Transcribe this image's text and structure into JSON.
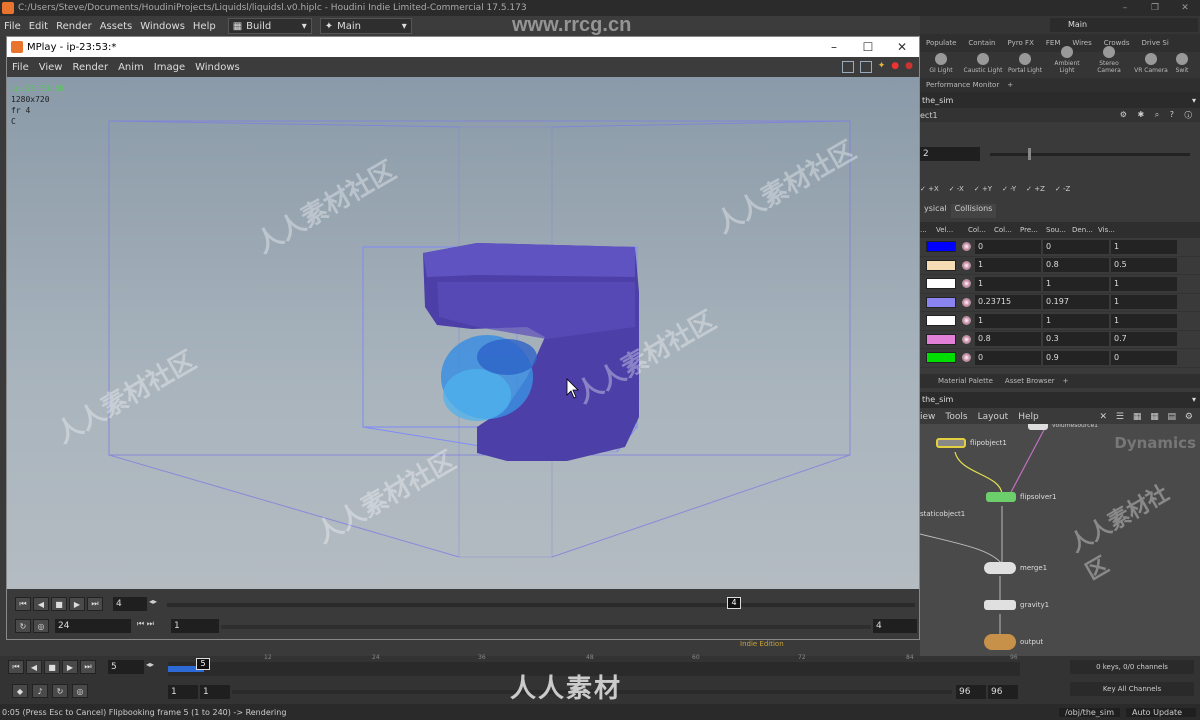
{
  "titlebar": {
    "title": "C:/Users/Steve/Documents/HoudiniProjects/Liquidsl/liquidsl.v0.hiplc - Houdini Indie Limited-Commercial 17.5.173"
  },
  "menubar": {
    "items": [
      "File",
      "Edit",
      "Render",
      "Assets",
      "Windows",
      "Help"
    ],
    "desktop": "Build",
    "main": "Main"
  },
  "watermark": {
    "url": "www.rrcg.cn",
    "text": "人人素材社区",
    "brand": "人人素材"
  },
  "shelf": {
    "main_label": "Main",
    "tabs": [
      "Populate",
      "Contain",
      "Pyro FX",
      "FEM",
      "Wires",
      "Crowds",
      "Drive Si"
    ],
    "tools": [
      "GI Light",
      "Caustic Light",
      "Portal Light",
      "Ambient Light",
      "Stereo Camera",
      "VR Camera",
      "Swit"
    ]
  },
  "mplay": {
    "title": "MPlay - ip-23:53:*",
    "menu": [
      "File",
      "View",
      "Render",
      "Anim",
      "Image",
      "Windows"
    ],
    "info": {
      "name": "ip-23:53:36",
      "res": "1280x720",
      "frame": "fr 4",
      "channel": "C"
    },
    "frame_field": "4",
    "fps_field": "24",
    "range_start": "1",
    "range_end": "4",
    "marker": "4"
  },
  "right_panel": {
    "perf_tab": "Performance Monitor",
    "path": "the_sim",
    "node_label": "ect1",
    "param_value": "2",
    "axes": [
      "+X",
      "-X",
      "+Y",
      "-Y",
      "+Z",
      "-Z"
    ],
    "subtabs": [
      "ysical",
      "Collisions"
    ],
    "columns": [
      "...",
      "Vel...",
      "Col...",
      "Col...",
      "Pre...",
      "Sou...",
      "Den...",
      "Vis..."
    ],
    "rows": [
      {
        "color": "#0000ff",
        "a": "0",
        "b": "0",
        "c": "1"
      },
      {
        "color": "#f5dcb4",
        "a": "1",
        "b": "0.8",
        "c": "0.5"
      },
      {
        "color": "#ffffff",
        "a": "1",
        "b": "1",
        "c": "1"
      },
      {
        "color": "#8a83f0",
        "a": "0.23715",
        "b": "0.197",
        "c": "1"
      },
      {
        "color": "#ffffff",
        "a": "1",
        "b": "1",
        "c": "1"
      },
      {
        "color": "#e27fd6",
        "a": "0.8",
        "b": "0.3",
        "c": "0.7"
      },
      {
        "color": "#00dd00",
        "a": "0",
        "b": "0.9",
        "c": "0"
      }
    ],
    "net_tabs": [
      "Material Palette",
      "Asset Browser"
    ],
    "net_path": "the_sim",
    "net_menu": [
      "iew",
      "Tools",
      "Layout",
      "Help"
    ],
    "net_title": "Dynamics",
    "nodes": [
      "flipobject1",
      "flipsolver1",
      "staticobject1",
      "merge1",
      "gravity1",
      "output",
      "volumesource1"
    ]
  },
  "timeline": {
    "frame": "5",
    "ticks": [
      "5",
      "12",
      "24",
      "36",
      "48",
      "60",
      "72",
      "84",
      "96"
    ],
    "start1": "1",
    "start2": "1",
    "end1": "96",
    "end2": "96",
    "keys": "0 keys, 0/0 channels",
    "key_all": "Key All Channels",
    "indie": "Indie Edition"
  },
  "status": {
    "message": "0:05 (Press Esc to Cancel) Flipbooking frame 5 (1 to 240) -> Rendering",
    "path": "/obj/the_sim",
    "update": "Auto Update"
  }
}
